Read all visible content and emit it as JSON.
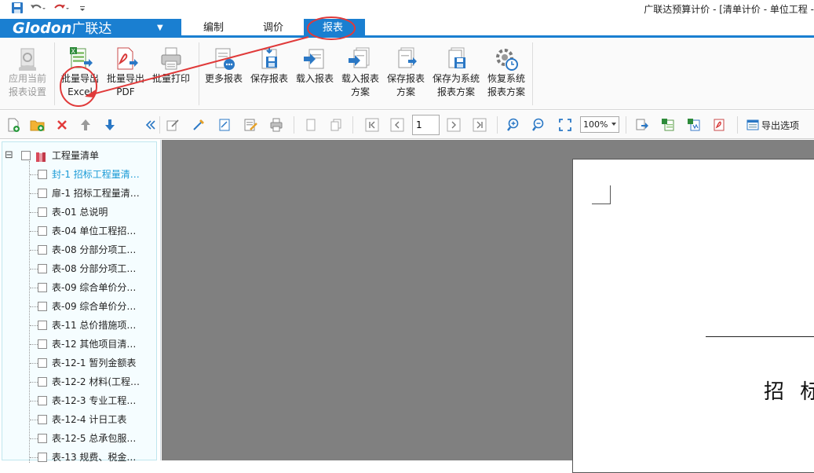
{
  "window": {
    "title": "广联达预算计价 - [清单计价 - 单位工程 -"
  },
  "quick_access": {
    "save_icon": "save-icon",
    "undo_icon": "undo-icon",
    "redo_icon": "redo-icon",
    "customize_icon": "customize-icon"
  },
  "brand": {
    "logo_latin": "Glodon",
    "logo_cn": "广联达",
    "menu_arrow": "▼"
  },
  "ribbon_tabs": [
    {
      "label": "编制",
      "active": false
    },
    {
      "label": "调价",
      "active": false
    },
    {
      "label": "报表",
      "active": true
    }
  ],
  "ribbon": {
    "buttons": [
      {
        "line1": "应用当前",
        "line2": "报表设置",
        "disabled": true,
        "icon": "report-settings-icon"
      },
      {
        "line1": "批量导出",
        "line2": "Excel",
        "disabled": false,
        "icon": "excel-export-icon"
      },
      {
        "line1": "批量导出",
        "line2": "PDF",
        "disabled": false,
        "icon": "pdf-export-icon"
      },
      {
        "line1": "批量打印",
        "line2": "",
        "disabled": false,
        "icon": "batch-print-icon"
      },
      {
        "line1": "更多报表",
        "line2": "",
        "disabled": false,
        "icon": "more-reports-icon"
      },
      {
        "line1": "保存报表",
        "line2": "",
        "disabled": false,
        "icon": "save-report-icon"
      },
      {
        "line1": "载入报表",
        "line2": "",
        "disabled": false,
        "icon": "load-report-icon"
      },
      {
        "line1": "载入报表",
        "line2": "方案",
        "disabled": false,
        "icon": "load-scheme-icon"
      },
      {
        "line1": "保存报表",
        "line2": "方案",
        "disabled": false,
        "icon": "save-scheme-icon"
      },
      {
        "line1": "保存为系统",
        "line2": "报表方案",
        "disabled": false,
        "icon": "save-system-scheme-icon"
      },
      {
        "line1": "恢复系统",
        "line2": "报表方案",
        "disabled": false,
        "icon": "restore-system-scheme-icon"
      }
    ]
  },
  "toolbar": {
    "page_input": "1",
    "zoom": "100%",
    "export_options": "导出选项"
  },
  "tree": {
    "root": "工程量清单",
    "collapse_glyph": "⊟",
    "items": [
      {
        "label": "封-1 招标工程量清…",
        "selected": true
      },
      {
        "label": "扉-1 招标工程量清…",
        "selected": false
      },
      {
        "label": "表-01 总说明",
        "selected": false
      },
      {
        "label": "表-04 单位工程招…",
        "selected": false
      },
      {
        "label": "表-08 分部分项工…",
        "selected": false
      },
      {
        "label": "表-08 分部分项工…",
        "selected": false
      },
      {
        "label": "表-09 综合单价分…",
        "selected": false
      },
      {
        "label": "表-09 综合单价分…",
        "selected": false
      },
      {
        "label": "表-11 总价措施项…",
        "selected": false
      },
      {
        "label": "表-12 其他项目清…",
        "selected": false
      },
      {
        "label": "表-12-1 暂列金额表",
        "selected": false
      },
      {
        "label": "表-12-2 材料(工程…",
        "selected": false
      },
      {
        "label": "表-12-3 专业工程…",
        "selected": false
      },
      {
        "label": "表-12-4 计日工表",
        "selected": false
      },
      {
        "label": "表-12-5 总承包服…",
        "selected": false
      },
      {
        "label": "表-13 规费、税金…",
        "selected": false
      }
    ]
  },
  "preview": {
    "heading_partial": "招 标"
  },
  "colors": {
    "accent": "#1a7fd1",
    "annotation": "#e03a3a",
    "selected_text": "#1a9ad6"
  }
}
